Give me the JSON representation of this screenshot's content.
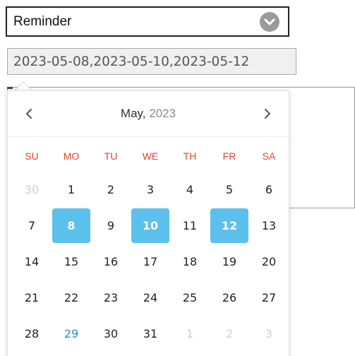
{
  "select": {
    "value": "Reminder"
  },
  "date_input": {
    "value": "2023-05-08,2023-05-10,2023-05-12"
  },
  "calendar": {
    "month_label": "May,",
    "year_label": "2023",
    "weekdays": [
      "SU",
      "MO",
      "TU",
      "WE",
      "TH",
      "FR",
      "SA"
    ],
    "weeks": [
      [
        {
          "label": "30",
          "state": "muted"
        },
        {
          "label": "1",
          "state": "normal"
        },
        {
          "label": "2",
          "state": "normal"
        },
        {
          "label": "3",
          "state": "normal"
        },
        {
          "label": "4",
          "state": "normal"
        },
        {
          "label": "5",
          "state": "normal"
        },
        {
          "label": "6",
          "state": "normal"
        }
      ],
      [
        {
          "label": "7",
          "state": "normal"
        },
        {
          "label": "8",
          "state": "selected"
        },
        {
          "label": "9",
          "state": "normal"
        },
        {
          "label": "10",
          "state": "selected"
        },
        {
          "label": "11",
          "state": "normal"
        },
        {
          "label": "12",
          "state": "selected"
        },
        {
          "label": "13",
          "state": "normal"
        }
      ],
      [
        {
          "label": "14",
          "state": "normal"
        },
        {
          "label": "15",
          "state": "normal"
        },
        {
          "label": "16",
          "state": "normal"
        },
        {
          "label": "17",
          "state": "normal"
        },
        {
          "label": "18",
          "state": "normal"
        },
        {
          "label": "19",
          "state": "normal"
        },
        {
          "label": "20",
          "state": "normal"
        }
      ],
      [
        {
          "label": "21",
          "state": "normal"
        },
        {
          "label": "22",
          "state": "normal"
        },
        {
          "label": "23",
          "state": "normal"
        },
        {
          "label": "24",
          "state": "normal"
        },
        {
          "label": "25",
          "state": "normal"
        },
        {
          "label": "26",
          "state": "normal"
        },
        {
          "label": "27",
          "state": "normal"
        }
      ],
      [
        {
          "label": "28",
          "state": "normal"
        },
        {
          "label": "29",
          "state": "today"
        },
        {
          "label": "30",
          "state": "normal"
        },
        {
          "label": "31",
          "state": "normal"
        },
        {
          "label": "1",
          "state": "muted"
        },
        {
          "label": "2",
          "state": "muted"
        },
        {
          "label": "3",
          "state": "muted"
        }
      ]
    ]
  },
  "icons": {
    "select_caret": "chevron-down-circle-icon",
    "prev": "chevron-left-icon",
    "next": "chevron-right-icon"
  },
  "colors": {
    "selected_bg": "#5bc0ec",
    "weekday_text": "#e0442e",
    "today_text": "#2a8fd4",
    "muted_text": "#cfcfcf"
  }
}
